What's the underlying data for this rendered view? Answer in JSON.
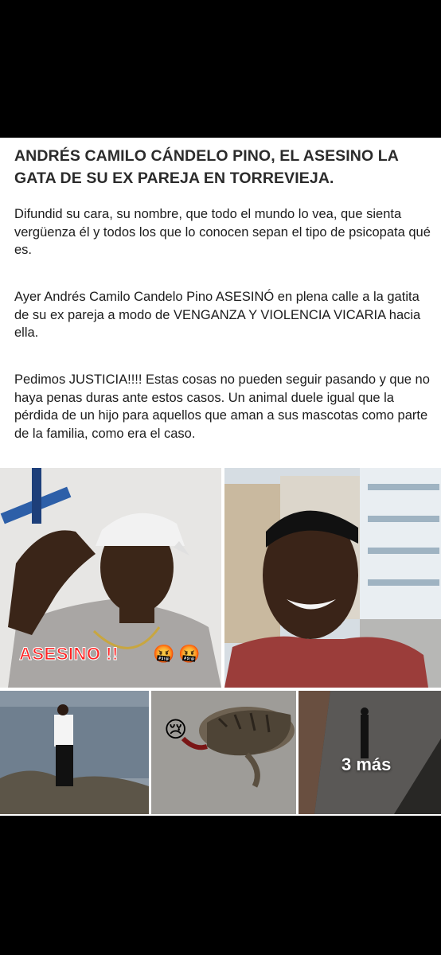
{
  "post": {
    "title": "ANDRÉS CAMILO CÁNDELO PINO, EL ASESINO LA GATA DE SU EX PAREJA EN TORREVIEJA.",
    "paragraphs": [
      "Difundid su cara, su nombre, que todo el mundo lo vea, que sienta vergüenza él y todos los que lo conocen sepan el tipo de psicopata qué es.",
      "Ayer Andrés Camilo Candelo Pino ASESINÓ en plena calle a la gatita de su ex pareja a modo de VENGANZA Y VIOLENCIA VICARIA hacia ella.",
      "Pedimos JUSTICIA!!!! Estas cosas no pueden seguir pasando y que no haya penas duras ante estos casos. Un animal duele igual que la pérdida de un hijo para aquellos que aman a sus mascotas como parte de la familia, como era el caso."
    ]
  },
  "photos": {
    "overlay_text": "ASESINO !!",
    "overlay_emoji": "🤬",
    "sad_emoji": "😢",
    "more_label": "3 más"
  },
  "colors": {
    "background": "#000000",
    "card": "#ffffff",
    "overlay_text": "#ff2323"
  }
}
